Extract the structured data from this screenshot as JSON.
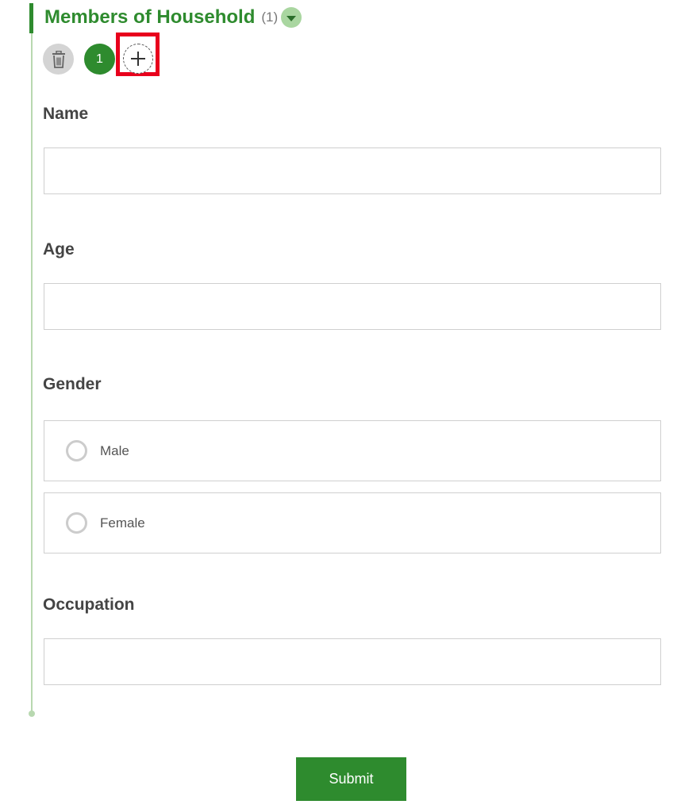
{
  "section": {
    "title": "Members of Household",
    "count": "(1)"
  },
  "toolbar": {
    "page_number": "1"
  },
  "fields": {
    "name": {
      "label": "Name",
      "value": "",
      "placeholder": ""
    },
    "age": {
      "label": "Age",
      "value": "",
      "placeholder": ""
    },
    "gender": {
      "label": "Gender",
      "options": [
        "Male",
        "Female"
      ]
    },
    "occupation": {
      "label": "Occupation",
      "value": "",
      "placeholder": ""
    }
  },
  "actions": {
    "submit_label": "Submit"
  },
  "icons": {
    "delete": "trash-icon",
    "add": "plus-icon",
    "collapse": "chevron-down-icon"
  },
  "colors": {
    "accent": "#2e8b2e",
    "highlight": "#e8001c"
  }
}
